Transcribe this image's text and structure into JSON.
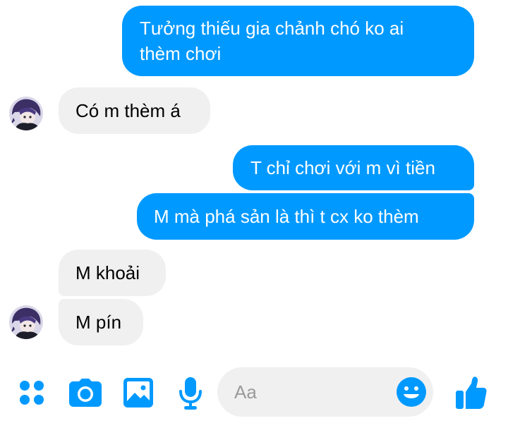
{
  "conversation": {
    "messages": [
      {
        "sender": "me",
        "text_lines": [
          "Tưởng thiếu gia chảnh chó ko ai",
          "thèm chơi"
        ]
      },
      {
        "sender": "them",
        "text": "Có m thèm á"
      },
      {
        "sender": "me",
        "text": "T chỉ chơi với m vì tiền"
      },
      {
        "sender": "me",
        "text": "M mà phá sản là thì t cx ko thèm"
      },
      {
        "sender": "them",
        "text": "M khoải"
      },
      {
        "sender": "them",
        "text": "M pín"
      }
    ]
  },
  "composer": {
    "placeholder": "Aa",
    "icons": [
      "menu-dots-icon",
      "camera-icon",
      "gallery-icon",
      "microphone-icon",
      "emoji-icon",
      "thumbs-up-icon"
    ]
  },
  "colors": {
    "outgoing_bubble": "#0099ff",
    "incoming_bubble": "#f1f0f0",
    "accent": "#0099ff"
  }
}
